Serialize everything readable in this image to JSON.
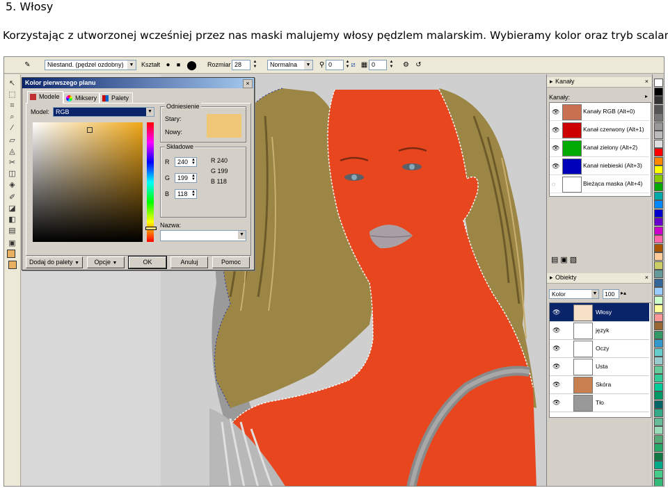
{
  "doc": {
    "heading_num": "5.",
    "heading_title": "Włosy",
    "paragraph": "Korzystając z utworzonej wcześniej przez nas maski malujemy włosy pędzlem malarskim. Wybieramy kolor oraz tryb scalania."
  },
  "propbar": {
    "brush_preset": "Niestand. (pędzel ozdobny)",
    "shape_label": "Kształt",
    "size_label": "Rozmiar",
    "size_value": "28",
    "blend_mode": "Normalna",
    "transparency_value": "0",
    "feather_value": "0"
  },
  "dialog": {
    "title": "Kolor pierwszego planu",
    "close": "×",
    "tabs": [
      "Modele",
      "Miksery",
      "Palety"
    ],
    "model_label": "Model:",
    "model_value": "RGB",
    "reference_title": "Odniesienie",
    "old_label": "Stary:",
    "new_label": "Nowy:",
    "new_color": "#f0c776",
    "components_title": "Składowe",
    "r_label": "R",
    "g_label": "G",
    "b_label": "B",
    "r_value": "240",
    "g_value": "199",
    "b_value": "118",
    "r_readout": "R  240",
    "g_readout": "G  199",
    "b_readout": "B  118",
    "name_label": "Nazwa:",
    "add_to_palette": "Dodaj do palety",
    "options": "Opcje",
    "ok": "OK",
    "cancel": "Anuluj",
    "help": "Pomoc"
  },
  "channels": {
    "panel_title": "Kanały",
    "list_label": "Kanały:",
    "items": [
      {
        "label": "Kanały RGB (Alt+0)",
        "color": "#c87050"
      },
      {
        "label": "Kanał czerwony (Alt+1)",
        "color": "#cc0000"
      },
      {
        "label": "Kanał zielony (Alt+2)",
        "color": "#00aa00"
      },
      {
        "label": "Kanał niebieski (Alt+3)",
        "color": "#0000bb"
      },
      {
        "label": "Bieżąca maska (Alt+4)",
        "color": "#ffffff"
      }
    ]
  },
  "objects": {
    "panel_title": "Obiekty",
    "mode_value": "Kolor",
    "opacity_value": "100",
    "items": [
      {
        "label": "Włosy",
        "selected": true
      },
      {
        "label": "język",
        "selected": false
      },
      {
        "label": "Oczy",
        "selected": false
      },
      {
        "label": "Usta",
        "selected": false
      },
      {
        "label": "Skóra",
        "selected": false
      },
      {
        "label": "Tło",
        "selected": false
      }
    ]
  },
  "palette_colors": [
    "#ffffff",
    "#000000",
    "#333333",
    "#555555",
    "#777777",
    "#999999",
    "#bbbbbb",
    "#dddddd",
    "#ff0000",
    "#ff8800",
    "#ffff00",
    "#88cc00",
    "#00aa00",
    "#00aaaa",
    "#0088ff",
    "#0000cc",
    "#6600cc",
    "#cc00cc",
    "#ff66aa",
    "#aa5500",
    "#ffcc99",
    "#cccc66",
    "#669999",
    "#336699",
    "#99ccff",
    "#ccffcc",
    "#ffff99",
    "#ff9999",
    "#996633",
    "#339966",
    "#3399cc",
    "#66cccc",
    "#99cccc",
    "#66cc99",
    "#33cc99",
    "#00cc99",
    "#009966",
    "#006666",
    "#33aa88",
    "#66bb99",
    "#99ddbb",
    "#55aa77",
    "#22aa66",
    "#117744",
    "#00aa88",
    "#44cc88",
    "#33bb77"
  ],
  "colors": {
    "skin_overlay": "#e8461f",
    "hair": "#a08a4a",
    "selected_row": "#0a246a"
  }
}
